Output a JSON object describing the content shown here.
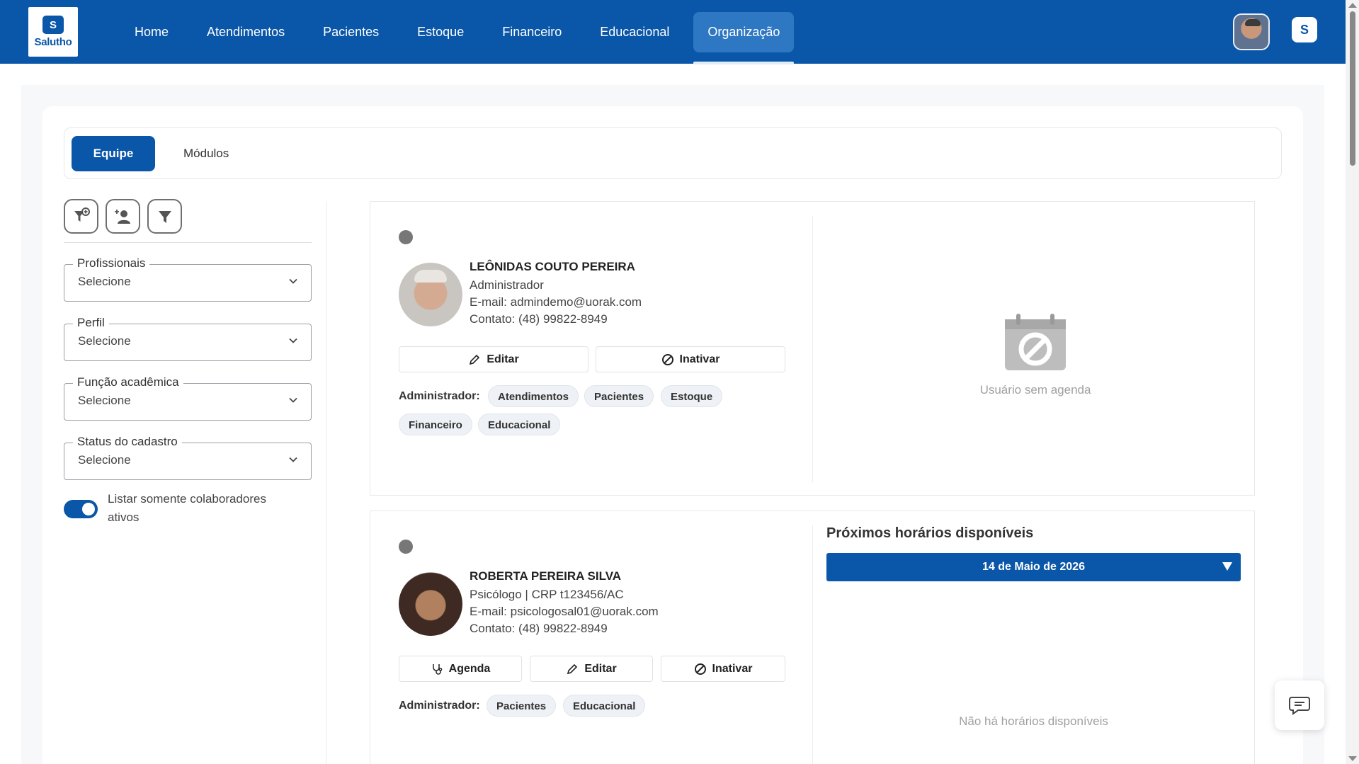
{
  "app": {
    "brand": "Salutho",
    "brand_mark": "S"
  },
  "nav": {
    "items": [
      {
        "label": "Home"
      },
      {
        "label": "Atendimentos"
      },
      {
        "label": "Pacientes"
      },
      {
        "label": "Estoque"
      },
      {
        "label": "Financeiro"
      },
      {
        "label": "Educacional"
      },
      {
        "label": "Organização"
      }
    ],
    "active": "Organização"
  },
  "tabs": [
    {
      "label": "Equipe",
      "active": true
    },
    {
      "label": "Módulos",
      "active": false
    }
  ],
  "filters": {
    "toolbar_icons": [
      "filter-add-icon",
      "add-user-icon",
      "filter-icon"
    ],
    "fields": [
      {
        "label": "Profissionais",
        "value": "Selecione"
      },
      {
        "label": "Perfil",
        "value": "Selecione"
      },
      {
        "label": "Função acadêmica",
        "value": "Selecione"
      },
      {
        "label": "Status do cadastro",
        "value": "Selecione"
      }
    ],
    "toggle": {
      "label": "Listar somente colaboradores ativos",
      "on": true
    }
  },
  "members": [
    {
      "name": "LEÔNIDAS COUTO PEREIRA",
      "role": "Administrador",
      "email": "E-mail: admindemo@uorak.com",
      "contact": "Contato: (48) 99822-8949",
      "actions": [
        {
          "label": "Editar",
          "icon": "pencil-icon"
        },
        {
          "label": "Inativar",
          "icon": "block-icon"
        }
      ],
      "permissions_label": "Administrador:",
      "modules": [
        "Atendimentos",
        "Pacientes",
        "Estoque",
        "Financeiro",
        "Educacional"
      ],
      "agenda_message": "Usuário sem agenda"
    },
    {
      "name": "ROBERTA PEREIRA SILVA",
      "role": "Psicólogo | CRP t123456/AC",
      "email": "E-mail: psicologosal01@uorak.com",
      "contact": "Contato: (48) 99822-8949",
      "actions": [
        {
          "label": "Agenda",
          "icon": "stethoscope-icon"
        },
        {
          "label": "Editar",
          "icon": "pencil-icon"
        },
        {
          "label": "Inativar",
          "icon": "block-icon"
        }
      ],
      "permissions_label": "Administrador:",
      "modules": [
        "Pacientes",
        "Educacional"
      ],
      "slots_title": "Próximos horários disponíveis",
      "slots_date": "14 de Maio de 2026",
      "slots_empty": "Não há horários disponíveis"
    }
  ],
  "colors": {
    "primary": "#0a56a8",
    "nav_active": "#2e77c2",
    "muted_text": "#a0a0a0"
  }
}
